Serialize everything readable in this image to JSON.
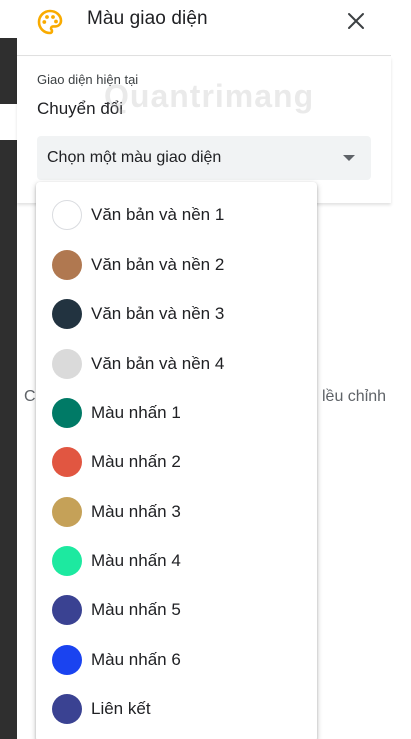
{
  "header": {
    "title": "Màu giao diện",
    "palette_icon": "palette-icon",
    "palette_color": "#f9ab00",
    "close_icon": "close-icon"
  },
  "current": {
    "label": "Giao diện hiện tại",
    "value": "Chuyển đổi"
  },
  "select": {
    "placeholder": "Chọn một màu giao diện"
  },
  "background_text": {
    "left": "C",
    "right": "lều chỉnh"
  },
  "watermark": "Quantrimang",
  "options": [
    {
      "label": "Văn bản và nền 1",
      "color": "#ffffff"
    },
    {
      "label": "Văn bản và nền 2",
      "color": "#b07850"
    },
    {
      "label": "Văn bản và nền 3",
      "color": "#223340"
    },
    {
      "label": "Văn bản và nền 4",
      "color": "#dadada"
    },
    {
      "label": "Màu nhấn 1",
      "color": "#007a66"
    },
    {
      "label": "Màu nhấn 2",
      "color": "#e15641"
    },
    {
      "label": "Màu nhấn 3",
      "color": "#c5a158"
    },
    {
      "label": "Màu nhấn 4",
      "color": "#1de9a0"
    },
    {
      "label": "Màu nhấn 5",
      "color": "#3a4292"
    },
    {
      "label": "Màu nhấn 6",
      "color": "#1a43f0"
    },
    {
      "label": "Liên kết",
      "color": "#3a4292"
    }
  ]
}
